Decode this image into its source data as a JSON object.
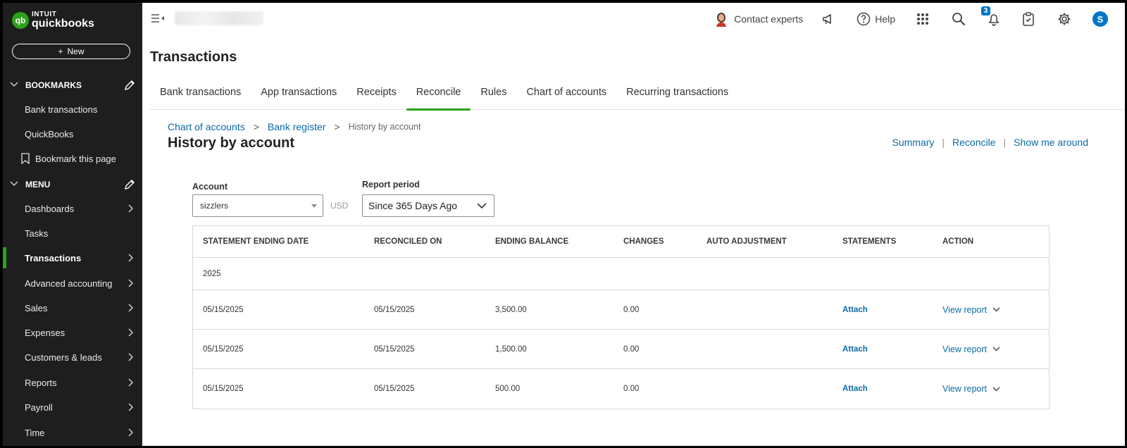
{
  "brand": {
    "line1": "INTUIT",
    "line2": "quickbooks",
    "mark": "qb"
  },
  "sidebar": {
    "new_button": "New",
    "bookmarks_header": "BOOKMARKS",
    "bookmarks": [
      {
        "label": "Bank transactions"
      },
      {
        "label": "QuickBooks"
      }
    ],
    "bookmark_page": "Bookmark this page",
    "menu_header": "MENU",
    "menu": [
      {
        "label": "Dashboards",
        "has_arrow": true
      },
      {
        "label": "Tasks",
        "has_arrow": false
      },
      {
        "label": "Transactions",
        "has_arrow": true,
        "active": true
      },
      {
        "label": "Advanced accounting",
        "has_arrow": true
      },
      {
        "label": "Sales",
        "has_arrow": true
      },
      {
        "label": "Expenses",
        "has_arrow": true
      },
      {
        "label": "Customers & leads",
        "has_arrow": true
      },
      {
        "label": "Reports",
        "has_arrow": true
      },
      {
        "label": "Payroll",
        "has_arrow": true
      },
      {
        "label": "Time",
        "has_arrow": true
      }
    ]
  },
  "header": {
    "contact": "Contact experts",
    "help": "Help",
    "notification_count": "3",
    "user_initial": "S"
  },
  "page": {
    "title": "Transactions",
    "tabs": [
      {
        "label": "Bank transactions"
      },
      {
        "label": "App transactions"
      },
      {
        "label": "Receipts"
      },
      {
        "label": "Reconcile",
        "active": true
      },
      {
        "label": "Rules"
      },
      {
        "label": "Chart of accounts"
      },
      {
        "label": "Recurring transactions"
      }
    ],
    "breadcrumb": {
      "crumb1": "Chart of accounts",
      "crumb2": "Bank register",
      "current": "History by account",
      "sep": ">"
    },
    "subtitle": "History by account",
    "links": {
      "summary": "Summary",
      "reconcile": "Reconcile",
      "tour": "Show me around",
      "sep": "|"
    }
  },
  "filters": {
    "account_label": "Account",
    "account_value": "sizzlers",
    "currency": "USD",
    "period_label": "Report period",
    "period_value": "Since 365 Days Ago"
  },
  "table": {
    "headers": [
      "STATEMENT ENDING DATE",
      "RECONCILED ON",
      "ENDING BALANCE",
      "CHANGES",
      "AUTO ADJUSTMENT",
      "STATEMENTS",
      "ACTION"
    ],
    "group": "2025",
    "rows": [
      {
        "ending_date": "05/15/2025",
        "reconciled_on": "05/15/2025",
        "balance": "3,500.00",
        "changes": "0.00",
        "auto_adj": "",
        "statement": "Attach",
        "action": "View report"
      },
      {
        "ending_date": "05/15/2025",
        "reconciled_on": "05/15/2025",
        "balance": "1,500.00",
        "changes": "0.00",
        "auto_adj": "",
        "statement": "Attach",
        "action": "View report"
      },
      {
        "ending_date": "05/15/2025",
        "reconciled_on": "05/15/2025",
        "balance": "500.00",
        "changes": "0.00",
        "auto_adj": "",
        "statement": "Attach",
        "action": "View report"
      }
    ]
  },
  "colors": {
    "accent": "#2ca01c",
    "link": "#0b6aa5",
    "sidebar": "#1e1e1e",
    "badge": "#0077c5"
  }
}
